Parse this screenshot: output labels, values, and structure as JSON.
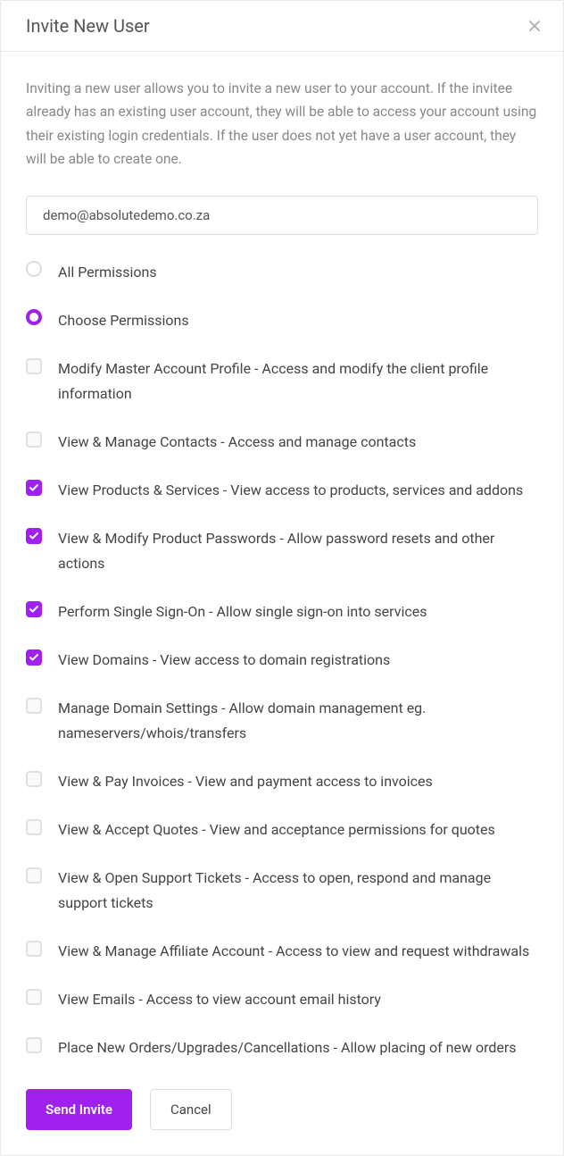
{
  "modal": {
    "title": "Invite New User",
    "description": "Inviting a new user allows you to invite a new user to your account. If the invitee already has an existing user account, they will be able to access your account using their existing login credentials. If the user does not yet have a user account, they will be able to create one.",
    "email_value": "demo@absolutedemo.co.za",
    "radio_options": {
      "all": "All Permissions",
      "choose": "Choose Permissions"
    },
    "permissions": [
      {
        "label": "Modify Master Account Profile - Access and modify the client profile information",
        "checked": false
      },
      {
        "label": "View & Manage Contacts - Access and manage contacts",
        "checked": false
      },
      {
        "label": "View Products & Services - View access to products, services and addons",
        "checked": true
      },
      {
        "label": "View & Modify Product Passwords - Allow password resets and other actions",
        "checked": true
      },
      {
        "label": "Perform Single Sign-On - Allow single sign-on into services",
        "checked": true
      },
      {
        "label": "View Domains - View access to domain registrations",
        "checked": true
      },
      {
        "label": "Manage Domain Settings - Allow domain management eg. nameservers/whois/transfers",
        "checked": false
      },
      {
        "label": "View & Pay Invoices - View and payment access to invoices",
        "checked": false
      },
      {
        "label": "View & Accept Quotes - View and acceptance permissions for quotes",
        "checked": false
      },
      {
        "label": "View & Open Support Tickets - Access to open, respond and manage support tickets",
        "checked": false
      },
      {
        "label": "View & Manage Affiliate Account - Access to view and request withdrawals",
        "checked": false
      },
      {
        "label": "View Emails - Access to view account email history",
        "checked": false
      },
      {
        "label": "Place New Orders/Upgrades/Cancellations - Allow placing of new orders",
        "checked": false
      }
    ],
    "buttons": {
      "send": "Send Invite",
      "cancel": "Cancel"
    }
  }
}
